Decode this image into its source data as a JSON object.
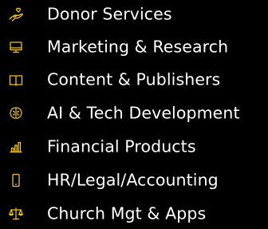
{
  "colors": {
    "background": "#000000",
    "text": "#ffffff",
    "icon": "#f2c418"
  },
  "menu": {
    "items": [
      {
        "label": "Donor Services",
        "icon": "hand-heart-icon"
      },
      {
        "label": "Marketing & Research",
        "icon": "monitor-icon"
      },
      {
        "label": "Content & Publishers",
        "icon": "open-book-icon"
      },
      {
        "label": "AI & Tech Development",
        "icon": "brain-icon"
      },
      {
        "label": "Financial Products",
        "icon": "bar-chart-icon"
      },
      {
        "label": "HR/Legal/Accounting",
        "icon": "mobile-phone-icon"
      },
      {
        "label": "Church Mgt & Apps",
        "icon": "balance-scale-icon"
      }
    ]
  }
}
